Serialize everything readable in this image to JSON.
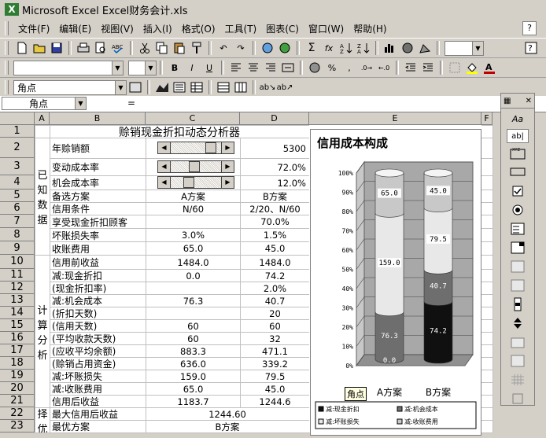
{
  "window": {
    "title": "Microsoft Excel  Excel财务会计.xls"
  },
  "menu": [
    "文件(F)",
    "编辑(E)",
    "视图(V)",
    "插入(I)",
    "格式(O)",
    "工具(T)",
    "图表(C)",
    "窗口(W)",
    "帮助(H)"
  ],
  "help_icon": "?",
  "toolbar": {
    "undo": "↶",
    "redo": "↷",
    "sum": "Σ",
    "fx": "fx",
    "percent": "%"
  },
  "formula_bar": {
    "name_box": "角点",
    "eq": "="
  },
  "columns": [
    "A",
    "B",
    "C",
    "D",
    "E",
    "F"
  ],
  "rows": [
    "1",
    "2",
    "3",
    "4",
    "5",
    "6",
    "7",
    "8",
    "9",
    "10",
    "11",
    "12",
    "13",
    "14",
    "15",
    "16",
    "17",
    "18",
    "19",
    "20",
    "21",
    "22",
    "23"
  ],
  "sheet": {
    "title": "赊销现金折扣动态分析器",
    "known_label": [
      "已",
      "知",
      "数",
      "据"
    ],
    "calc_label": [
      "计",
      "算",
      "分",
      "析"
    ],
    "choose_label": [
      "择",
      "优"
    ],
    "r2": {
      "b": "年赊销额",
      "d": "5300"
    },
    "r3": {
      "b": "变动成本率",
      "d": "72.0%"
    },
    "r4": {
      "b": "机会成本率",
      "d": "12.0%"
    },
    "r5": {
      "b": "备选方案",
      "c": "A方案",
      "d": "B方案"
    },
    "r6": {
      "b": "信用条件",
      "c": "N/60",
      "d": "2/20、N/60"
    },
    "r7": {
      "b": "享受现金折扣顾客",
      "c": "",
      "d": "70.0%"
    },
    "r8": {
      "b": "坏账损失率",
      "c": "3.0%",
      "d": "1.5%"
    },
    "r9": {
      "b": "收账费用",
      "c": "65.0",
      "d": "45.0"
    },
    "r10": {
      "b": "信用前收益",
      "c": "1484.0",
      "d": "1484.0"
    },
    "r11": {
      "b": "减:现金折扣",
      "c": "0.0",
      "d": "74.2"
    },
    "r12": {
      "b": "  (现金折扣率)",
      "c": "",
      "d": "2.0%"
    },
    "r13": {
      "b": "减:机会成本",
      "c": "76.3",
      "d": "40.7"
    },
    "r14": {
      "b": "  (折扣天数)",
      "c": "",
      "d": "20"
    },
    "r15": {
      "b": "  (信用天数)",
      "c": "60",
      "d": "60"
    },
    "r16": {
      "b": "  (平均收款天数)",
      "c": "60",
      "d": "32"
    },
    "r17": {
      "b": "  (应收平均余额)",
      "c": "883.3",
      "d": "471.1"
    },
    "r18": {
      "b": "  (赊销占用资金)",
      "c": "636.0",
      "d": "339.2"
    },
    "r19": {
      "b": "减:坏账损失",
      "c": "159.0",
      "d": "79.5"
    },
    "r20": {
      "b": "减:收账费用",
      "c": "65.0",
      "d": "45.0"
    },
    "r21": {
      "b": "信用后收益",
      "c": "1183.7",
      "d": "1244.6"
    },
    "r22": {
      "b": "最大信用后收益",
      "cd": "1244.60"
    },
    "r23": {
      "b": "最优方案",
      "cd": "B方案"
    }
  },
  "sliders": {
    "r2": 0.85,
    "r3": 0.45,
    "r4": 0.3
  },
  "tooltip": "角点",
  "chart_data": {
    "type": "bar",
    "title": "信用成本构成",
    "categories": [
      "A方案",
      "B方案"
    ],
    "yticks": [
      "0%",
      "10%",
      "20%",
      "30%",
      "40%",
      "50%",
      "60%",
      "70%",
      "80%",
      "90%",
      "100%"
    ],
    "series": [
      {
        "name": "减:现金折扣",
        "values": [
          0.0,
          74.2
        ],
        "color": "#101010"
      },
      {
        "name": "减:机会成本",
        "values": [
          76.3,
          40.7
        ],
        "color": "#6e6e6e"
      },
      {
        "name": "减:坏账损失",
        "values": [
          159.0,
          79.5
        ],
        "color": "#e8e8e8"
      },
      {
        "name": "减:收账费用",
        "values": [
          65.0,
          45.0
        ],
        "color": "#c8c8c8"
      }
    ],
    "data_labels": [
      [
        "",
        "76.3",
        "159.0",
        "65.0"
      ],
      [
        "74.2",
        "40.7",
        "79.5",
        "45.0"
      ]
    ],
    "legend_position": "bottom"
  }
}
